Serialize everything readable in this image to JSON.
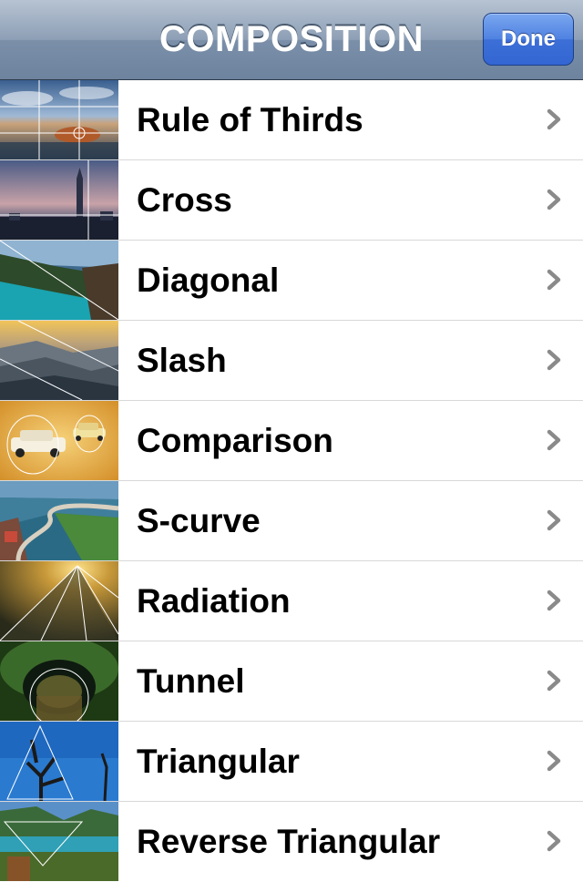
{
  "navbar": {
    "title": "COMPOSITION",
    "done_label": "Done"
  },
  "rows": [
    {
      "label": "Rule of Thirds"
    },
    {
      "label": "Cross"
    },
    {
      "label": "Diagonal"
    },
    {
      "label": "Slash"
    },
    {
      "label": "Comparison"
    },
    {
      "label": "S-curve"
    },
    {
      "label": "Radiation"
    },
    {
      "label": "Tunnel"
    },
    {
      "label": "Triangular"
    },
    {
      "label": "Reverse Triangular"
    }
  ],
  "colors": {
    "navbar": "#7b8fa9",
    "done_button": "#3c6fd6",
    "separator": "#d8d8d8",
    "chevron": "#8a8a8a"
  }
}
